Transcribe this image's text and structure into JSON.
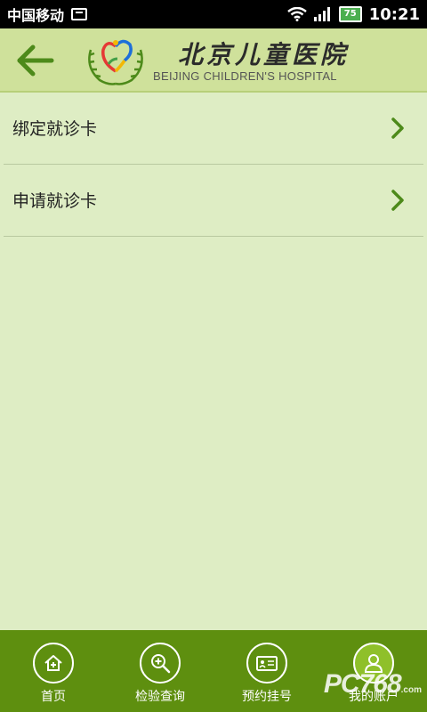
{
  "status_bar": {
    "carrier": "中国移动",
    "battery": "75",
    "time": "10:21"
  },
  "header": {
    "title_cn": "北京儿童医院",
    "title_en": "BEIJING CHILDREN'S HOSPITAL"
  },
  "menu": [
    {
      "label": "绑定就诊卡"
    },
    {
      "label": "申请就诊卡"
    }
  ],
  "bottom_nav": [
    {
      "label": "首页",
      "icon": "home-icon"
    },
    {
      "label": "检验查询",
      "icon": "search-icon"
    },
    {
      "label": "预约挂号",
      "icon": "card-icon"
    },
    {
      "label": "我的账户",
      "icon": "user-icon",
      "active": true
    }
  ],
  "watermark": {
    "text": "PC768",
    "sub": ".com"
  },
  "colors": {
    "header_bg": "#cfe19b",
    "body_bg": "#deedc4",
    "nav_bg": "#5e8f0f",
    "accent": "#4d8a1a"
  }
}
